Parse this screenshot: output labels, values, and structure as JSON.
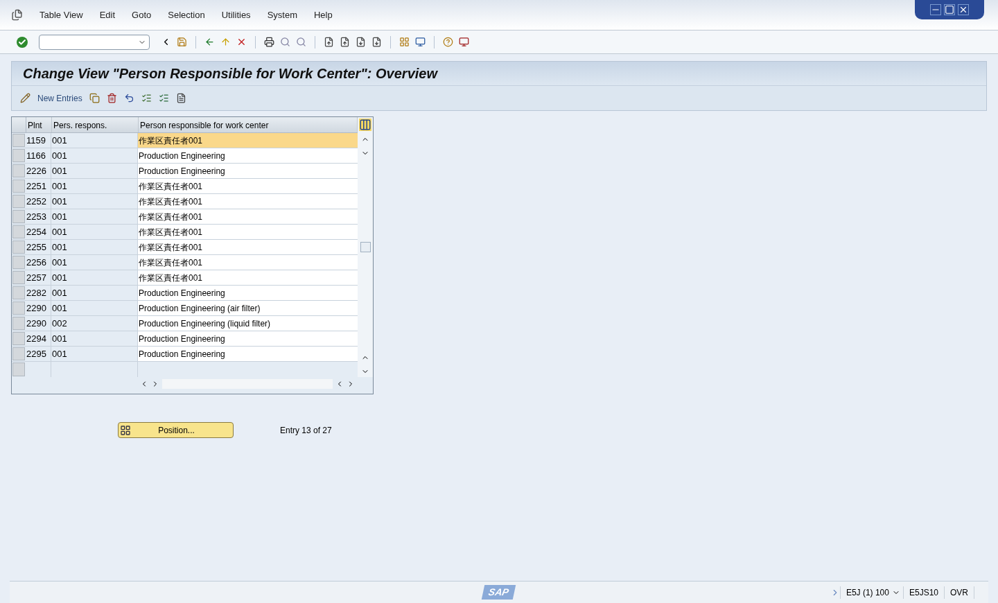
{
  "menu": [
    "Table View",
    "Edit",
    "Goto",
    "Selection",
    "Utilities",
    "System",
    "Help"
  ],
  "title": "Change View \"Person Responsible for Work Center\": Overview",
  "app_toolbar": {
    "new_entries": "New Entries"
  },
  "table": {
    "columns": [
      "Plnt",
      "Pers. respons.",
      "Person responsible for work center"
    ],
    "rows": [
      {
        "plnt": "1159",
        "pers": "001",
        "name": "作業区責任者001",
        "selected": true
      },
      {
        "plnt": "1166",
        "pers": "001",
        "name": "Production Engineering",
        "selected": false
      },
      {
        "plnt": "2226",
        "pers": "001",
        "name": "Production Engineering",
        "selected": false
      },
      {
        "plnt": "2251",
        "pers": "001",
        "name": "作業区責任者001",
        "selected": false
      },
      {
        "plnt": "2252",
        "pers": "001",
        "name": "作業区責任者001",
        "selected": false
      },
      {
        "plnt": "2253",
        "pers": "001",
        "name": "作業区責任者001",
        "selected": false
      },
      {
        "plnt": "2254",
        "pers": "001",
        "name": "作業区責任者001",
        "selected": false
      },
      {
        "plnt": "2255",
        "pers": "001",
        "name": "作業区責任者001",
        "selected": false
      },
      {
        "plnt": "2256",
        "pers": "001",
        "name": "作業区責任者001",
        "selected": false
      },
      {
        "plnt": "2257",
        "pers": "001",
        "name": "作業区責任者001",
        "selected": false
      },
      {
        "plnt": "2282",
        "pers": "001",
        "name": "Production Engineering",
        "selected": false
      },
      {
        "plnt": "2290",
        "pers": "001",
        "name": "Production Engineering (air filter)",
        "selected": false
      },
      {
        "plnt": "2290",
        "pers": "002",
        "name": "Production Engineering (liquid filter)",
        "selected": false
      },
      {
        "plnt": "2294",
        "pers": "001",
        "name": "Production Engineering",
        "selected": false
      },
      {
        "plnt": "2295",
        "pers": "001",
        "name": "Production Engineering",
        "selected": false
      }
    ]
  },
  "position_button": "Position...",
  "entry_info": "Entry 13 of 27",
  "status_bar": {
    "logo": "SAP",
    "system": "E5J (1) 100",
    "server": "E5JS10",
    "mode": "OVR"
  }
}
